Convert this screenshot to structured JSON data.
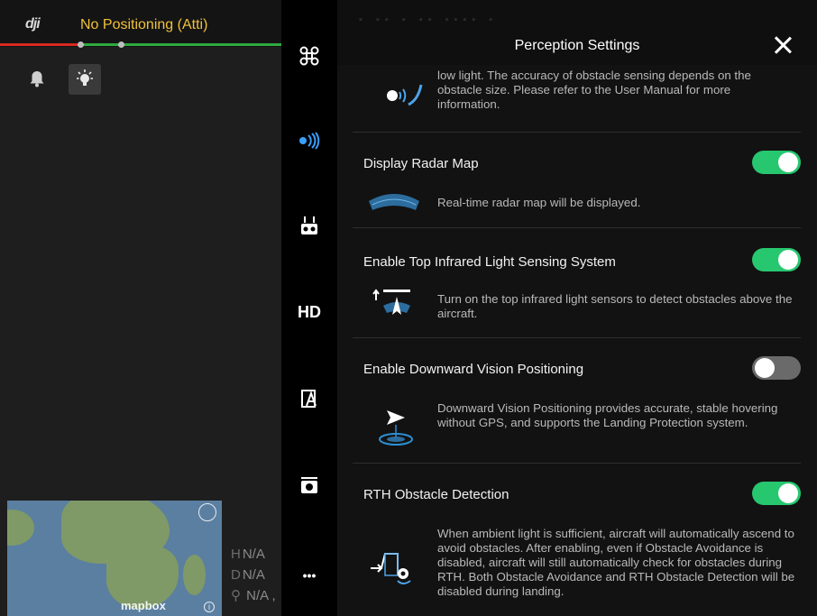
{
  "app": {
    "logo": "dji",
    "flight_mode": "No Positioning (Atti)"
  },
  "map": {
    "brand": "mapbox",
    "info_glyph": "i"
  },
  "telemetry": {
    "h_label": "H",
    "h_value": "N/A",
    "d_label": "D",
    "d_value": "N/A",
    "loc_value": "N/A ,"
  },
  "sidenav": {
    "items": [
      {
        "name": "aircraft-settings-icon"
      },
      {
        "name": "perception-icon"
      },
      {
        "name": "remote-controller-icon"
      },
      {
        "name": "hd-transmission-icon",
        "label": "HD"
      },
      {
        "name": "battery-icon"
      },
      {
        "name": "camera-icon"
      },
      {
        "name": "more-icon",
        "label": "•••"
      }
    ]
  },
  "panel": {
    "title": "Perception Settings",
    "intro_text": "low light. The accuracy of obstacle sensing depends on the obstacle size. Please refer to the User Manual for more information.",
    "rows": [
      {
        "title": "Display Radar Map",
        "toggle": "on",
        "description": "Real-time radar map will be displayed."
      },
      {
        "title": "Enable Top Infrared Light Sensing System",
        "toggle": "on",
        "description": "Turn on the top infrared light sensors to detect obstacles above the aircraft."
      },
      {
        "title": "Enable Downward Vision Positioning",
        "toggle": "off",
        "description": "Downward Vision Positioning provides accurate, stable hovering without GPS, and supports the Landing Protection system."
      },
      {
        "title": "RTH Obstacle Detection",
        "toggle": "on",
        "description": "When ambient light is sufficient, aircraft will automatically ascend to avoid obstacles. After enabling, even if Obstacle Avoidance is disabled, aircraft will still automatically check for obstacles during RTH. Both Obstacle Avoidance and RTH Obstacle Detection will be disabled during landing."
      }
    ]
  },
  "colors": {
    "toggle_on": "#27c76f",
    "toggle_off": "#6a6a6a",
    "flight_mode_text": "#f0c23a",
    "status_red": "#d6281f",
    "status_green": "#2faa3f"
  }
}
